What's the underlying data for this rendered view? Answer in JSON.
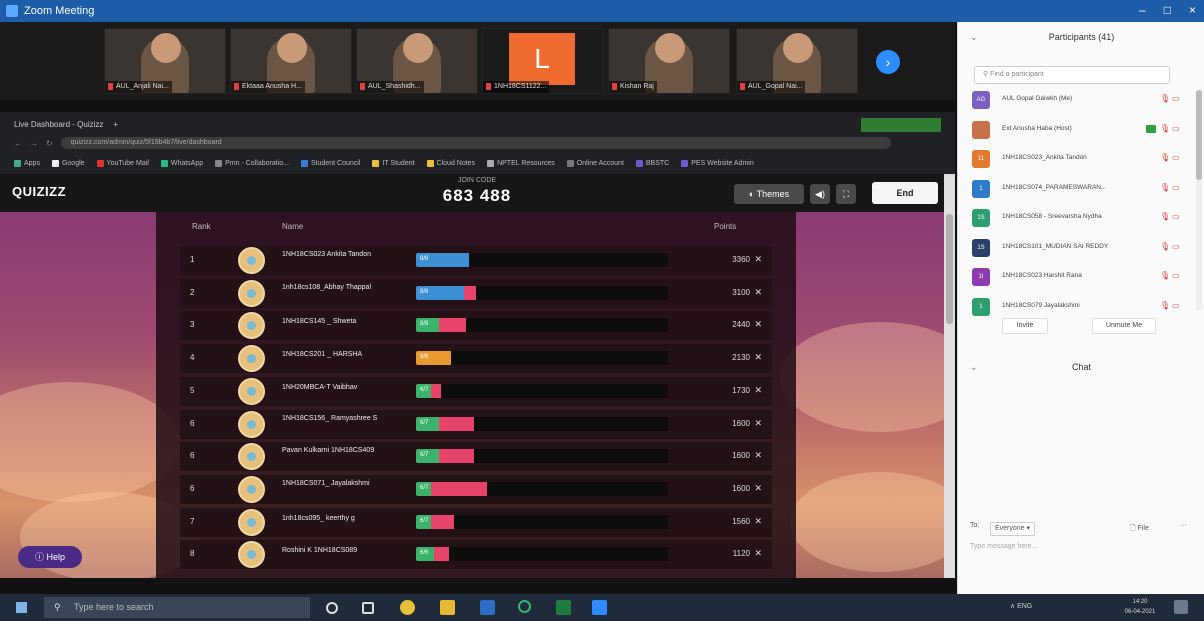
{
  "window": {
    "title": "Zoom Meeting",
    "controls": [
      "–",
      "□",
      "×"
    ]
  },
  "video_tiles": [
    {
      "name": "AUL_Anjali Nai..."
    },
    {
      "name": "Ektaaa Anusha H..."
    },
    {
      "name": "AUL_Shashidh..."
    },
    {
      "name": "1NH18CS1122...",
      "initial": "L"
    },
    {
      "name": "Kishan Raj"
    },
    {
      "name": "AUL_Gopal Nai..."
    }
  ],
  "browser": {
    "tab_label": "Live Dashboard - Quizizz",
    "address": "quizizz.com/admin/quiz/5f19b4b7/live/dashboard",
    "bookmarks": [
      "Apps",
      "Google",
      "YouTube Mail",
      "WhatsApp",
      "Pmn - Collaboratio...",
      "Student Council",
      "IT Student",
      "Cloud Notes",
      "NPTEL Resources",
      "Online Account",
      "BBSTC",
      "PES Website Admin"
    ]
  },
  "quiz": {
    "logo": "QUIZIZZ",
    "join_label": "JOIN CODE",
    "join_code": "683 488",
    "themes_label": "Themes",
    "end_label": "End",
    "head_rank": "Rank",
    "head_name": "Name",
    "head_points": "Points",
    "help_label": "Help"
  },
  "leaderboard": [
    {
      "rank": "1",
      "name": "1NH18CS023 Ankita Tandon",
      "acc": "8/8",
      "correct": 0.21,
      "wrong": 0.0,
      "points": "3360"
    },
    {
      "rank": "2",
      "name": "1nh18cs108_Abhay Thappal",
      "acc": "8/8",
      "correct": 0.19,
      "wrong": 0.05,
      "points": "3100"
    },
    {
      "rank": "3",
      "name": "1NH18CS145 _ Shweta",
      "acc": "8/8",
      "correct": 0.09,
      "wrong": 0.11,
      "points": "2440"
    },
    {
      "rank": "4",
      "name": "1NH18CS201 _ HARSHA",
      "acc": "8/8",
      "correct": 0.14,
      "wrong": 0.0,
      "points": "2130"
    },
    {
      "rank": "5",
      "name": "1NH20MBCA-T Vaibhav",
      "acc": "6/7",
      "correct": 0.06,
      "wrong": 0.04,
      "points": "1730"
    },
    {
      "rank": "6",
      "name": "1NH18CS156_ Ramyashree S",
      "acc": "6/7",
      "correct": 0.09,
      "wrong": 0.14,
      "points": "1600"
    },
    {
      "rank": "6",
      "name": "Pavan Kulkarni 1NH18CS409",
      "acc": "6/7",
      "correct": 0.09,
      "wrong": 0.14,
      "points": "1600"
    },
    {
      "rank": "6",
      "name": "1NH18CS071_ Jayalakshmi",
      "acc": "6/7",
      "correct": 0.06,
      "wrong": 0.22,
      "points": "1600"
    },
    {
      "rank": "7",
      "name": "1nh18cs095_ keerthy g",
      "acc": "6/7",
      "correct": 0.06,
      "wrong": 0.09,
      "points": "1560"
    },
    {
      "rank": "8",
      "name": "Roshini K 1NH18CS089",
      "acc": "6/6",
      "correct": 0.07,
      "wrong": 0.06,
      "points": "1120"
    }
  ],
  "participants": {
    "title": "Participants (41)",
    "search_placeholder": "Find a participant",
    "list": [
      {
        "initials": "AG",
        "name": "AUL Gopal Gaiwkh (Me)",
        "color": "#7b61c2"
      },
      {
        "initials": "",
        "name": "Ext Anusha Haba (Host)",
        "color": "#c8704a",
        "share": true
      },
      {
        "initials": "11",
        "name": "1NH18CS023_Ankita Tandon",
        "color": "#e2792e"
      },
      {
        "initials": "1",
        "name": "1NH18CS074_PARAMESWARAN...",
        "color": "#2e7bc7"
      },
      {
        "initials": "1S",
        "name": "1NH18CS058 - Sreevarsha Nydha",
        "color": "#2e9e6e"
      },
      {
        "initials": "1S",
        "name": "1NH18CS101_MUDIAN SAI REDDY",
        "color": "#2a3f6b"
      },
      {
        "initials": "1I",
        "name": "1NH18CS023 Harshit Rana",
        "color": "#8e3bb0"
      },
      {
        "initials": "1",
        "name": "1NH18CS079 Jayalakshmi",
        "color": "#2e9e6e"
      }
    ],
    "invite_label": "Invite",
    "unmute_label": "Unmute Me"
  },
  "chat": {
    "title": "Chat",
    "to_label": "To:",
    "recipient": "Everyone",
    "file_label": "File",
    "placeholder": "Type message here..."
  },
  "taskbar": {
    "search_placeholder": "Type here to search",
    "tray": "∧  ENG",
    "time": "14:20",
    "date": "06-04-2021"
  },
  "colors": {
    "correct": "#3ab46b",
    "wrong": "#e8436a",
    "first_correct": "#3d8fd6",
    "fourth": "#e89a2e"
  }
}
